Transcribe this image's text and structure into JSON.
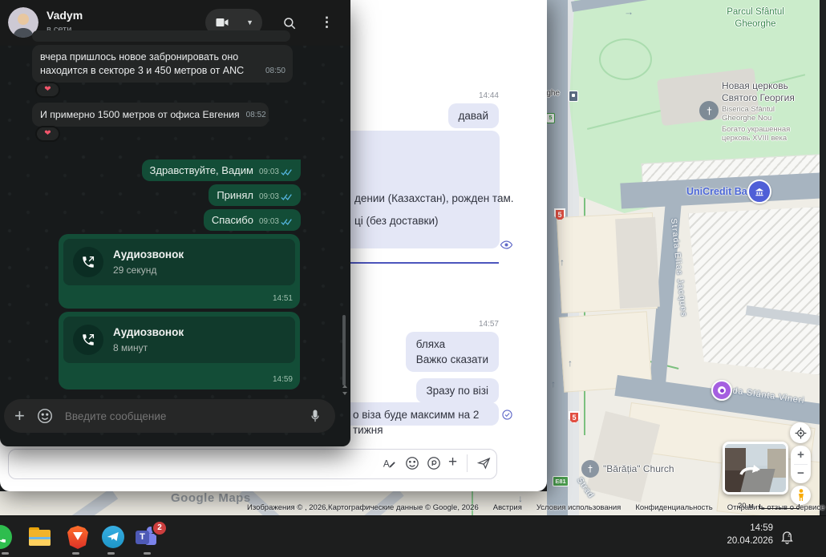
{
  "wa": {
    "name": "Vadym",
    "status": "в сети",
    "m1": "вчера пришлось новое забронировать оно находится в секторе 3 и 450 метров от ANC",
    "m1_time": "08:50",
    "m2": "И примерно 1500 метров от офиса Евгения",
    "m2_time": "08:52",
    "reaction": "❤",
    "g1": "Здравствуйте, Вадим",
    "g1_time": "09:03",
    "g2": "Принял",
    "g2_time": "09:03",
    "g3": "Спасибо",
    "g3_time": "09:03",
    "call_title": "Аудиозвонок",
    "call1_sub": "29 секунд",
    "call1_time": "14:51",
    "call2_sub": "8 минут",
    "call2_time": "14:59",
    "placeholder": "Введите сообщение"
  },
  "viber": {
    "ts1": "14:44",
    "msg1": "давай",
    "msg2_line1": "дении (Казахстан), рожден там.",
    "msg2_line2": "ці (без доставки)",
    "ts2": "14:57",
    "msg3_line1": "бляха",
    "msg3_line2": "Важко сказати",
    "msg4": "Зразу по візі",
    "msg5": "о віза буде максимм на 2 тижня"
  },
  "map": {
    "park_l1": "Parcul Sfântul",
    "park_l2": "Gheorghe",
    "church_title_l1": "Новая церковь",
    "church_title_l2": "Святого Георгия",
    "church_sub_l1": "Biserica Sfântul",
    "church_sub_l2": "Gheorghe Nou",
    "church_desc_l1": "Богато украшенная",
    "church_desc_l2": "церковь XVIII века",
    "bank": "UniCredit Bank",
    "street1": "Strada Elias Jacques",
    "street2": "Strada Sfânta Vineri",
    "street3": "Strad",
    "stop_label": "rghe",
    "stop_num": "5",
    "church2": "\"Bărăția\" Church",
    "shield1": "5",
    "shield2": "5",
    "shield_e": "E81",
    "watermark": "Google Maps",
    "zoom_in": "+",
    "zoom_out": "−",
    "attribution": {
      "images": "Изображения © , 2026,Картографические данные © Google, 2026",
      "region": "Австрия",
      "terms": "Условия использования",
      "privacy": "Конфиденциальность",
      "feedback": "Отправить отзыв о сервисе",
      "scale": "20 м"
    }
  },
  "taskbar": {
    "clock_time": "14:59",
    "clock_date": "20.04.2026",
    "teams_badge": "2"
  }
}
